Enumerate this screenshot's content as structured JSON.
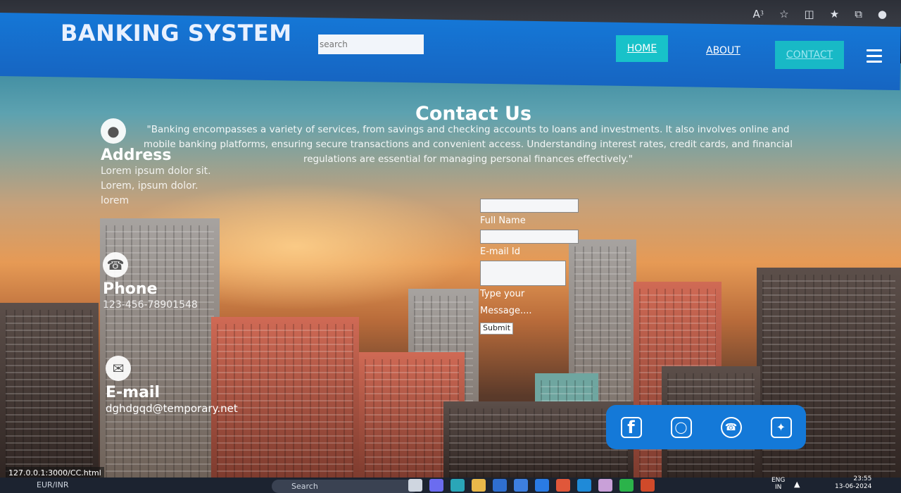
{
  "browser": {
    "toolbar_icons": [
      "read-aloud-icon",
      "favorite-star-icon",
      "split-screen-icon",
      "favorites-icon",
      "collections-icon",
      "copilot-icon"
    ]
  },
  "navbar": {
    "brand": "BANKING SYSTEM",
    "search_placeholder": "search",
    "links": {
      "home": "HOME",
      "about": "ABOUT",
      "contact": "CONTACT"
    },
    "colors": {
      "bar": "#1577d6",
      "active_link_bg": "#18c2c9"
    }
  },
  "contact": {
    "title": "Contact Us",
    "description": "\"Banking encompasses a variety of services, from savings and checking accounts to loans and investments. It also involves online and mobile banking platforms, ensuring secure transactions and convenient access. Understanding interest rates, credit cards, and financial regulations are essential for managing personal finances effectively.\"",
    "address": {
      "heading": "Address",
      "lines": [
        "Lorem ipsum dolor sit.",
        "Lorem, ipsum dolor.",
        "lorem"
      ]
    },
    "phone": {
      "heading": "Phone",
      "value": "123-456-78901548"
    },
    "email": {
      "heading": "E-mail",
      "value": "dghdgqd@temporary.net"
    }
  },
  "form": {
    "full_name_label": "Full Name",
    "email_label": "E-mail Id",
    "message_label": "Type your Message....",
    "submit_label": "Submit"
  },
  "social": [
    "facebook-icon",
    "instagram-icon",
    "whatsapp-icon",
    "twitter-icon"
  ],
  "status_url": "127.0.0.1:3000/CC.html",
  "taskbar": {
    "widget": "EUR/INR",
    "search_label": "Search",
    "language": "ENG",
    "region": "IN",
    "time": "23:55",
    "date": "13-06-2024"
  }
}
